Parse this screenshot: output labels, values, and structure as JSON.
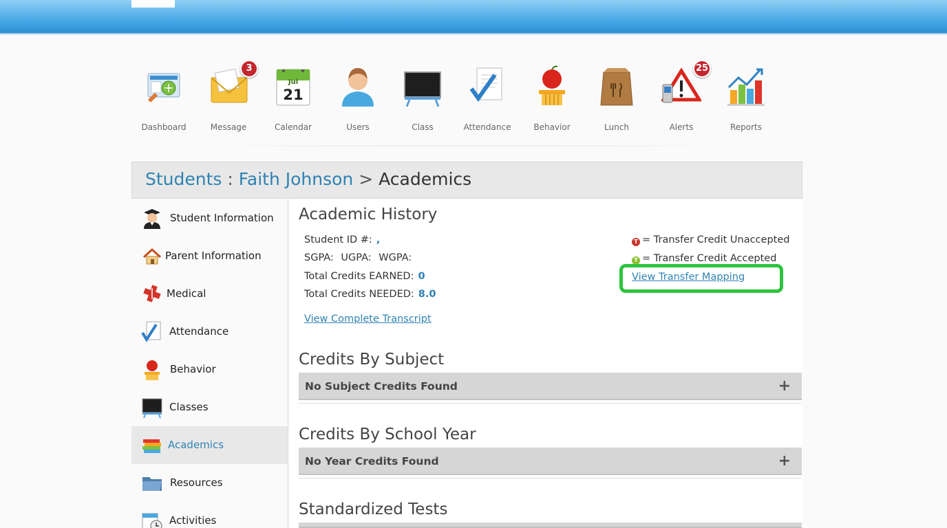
{
  "nav": {
    "items": [
      {
        "label": "Dashboard",
        "icon": "dashboard-icon"
      },
      {
        "label": "Message",
        "icon": "message-icon",
        "badge": "3"
      },
      {
        "label": "Calendar",
        "icon": "calendar-icon",
        "month": "Jul",
        "day": "21"
      },
      {
        "label": "Users",
        "icon": "users-icon"
      },
      {
        "label": "Class",
        "icon": "class-icon"
      },
      {
        "label": "Attendance",
        "icon": "attendance-icon"
      },
      {
        "label": "Behavior",
        "icon": "behavior-icon"
      },
      {
        "label": "Lunch",
        "icon": "lunch-icon"
      },
      {
        "label": "Alerts",
        "icon": "alerts-icon",
        "badge": "25"
      },
      {
        "label": "Reports",
        "icon": "reports-icon"
      }
    ]
  },
  "breadcrumb": {
    "students": "Students",
    "sep1": ":",
    "student_name": "Faith Johnson",
    "sep2": ">",
    "current": "Academics"
  },
  "sidebar": {
    "items": [
      {
        "label": "Student Information",
        "icon": "graduate-icon"
      },
      {
        "label": "Parent Information",
        "icon": "house-icon"
      },
      {
        "label": "Medical",
        "icon": "medical-icon"
      },
      {
        "label": "Attendance",
        "icon": "attendance-icon"
      },
      {
        "label": "Behavior",
        "icon": "apple-icon"
      },
      {
        "label": "Classes",
        "icon": "chalkboard-icon"
      },
      {
        "label": "Academics",
        "icon": "books-icon",
        "active": true
      },
      {
        "label": "Resources",
        "icon": "folder-icon"
      },
      {
        "label": "Activities",
        "icon": "clock-calendar-icon"
      }
    ]
  },
  "academic_history": {
    "title": "Academic History",
    "student_id_label": "Student ID #:",
    "student_id_value": ",",
    "sgpa_label": "SGPA:",
    "ugpa_label": "UGPA:",
    "wgpa_label": "WGPA:",
    "earned_label": "Total Credits EARNED:",
    "earned_value": "0",
    "needed_label": "Total Credits NEEDED:",
    "needed_value": "8.0",
    "transcript_link": "View Complete Transcript",
    "legend_unaccepted": "= Transfer Credit Unaccepted",
    "legend_accepted": "= Transfer Credit Accepted",
    "legend_badge": "T",
    "mapping_link": "View Transfer Mapping"
  },
  "credits_by_subject": {
    "title": "Credits By Subject",
    "empty": "No Subject Credits Found",
    "expand": "+"
  },
  "credits_by_year": {
    "title": "Credits By School Year",
    "empty": "No Year Credits Found",
    "expand": "+"
  },
  "standardized_tests": {
    "title": "Standardized Tests"
  },
  "colors": {
    "link_blue": "#2f82b3",
    "highlight_green": "#2ec43e",
    "badge_red": "#c4262e"
  }
}
